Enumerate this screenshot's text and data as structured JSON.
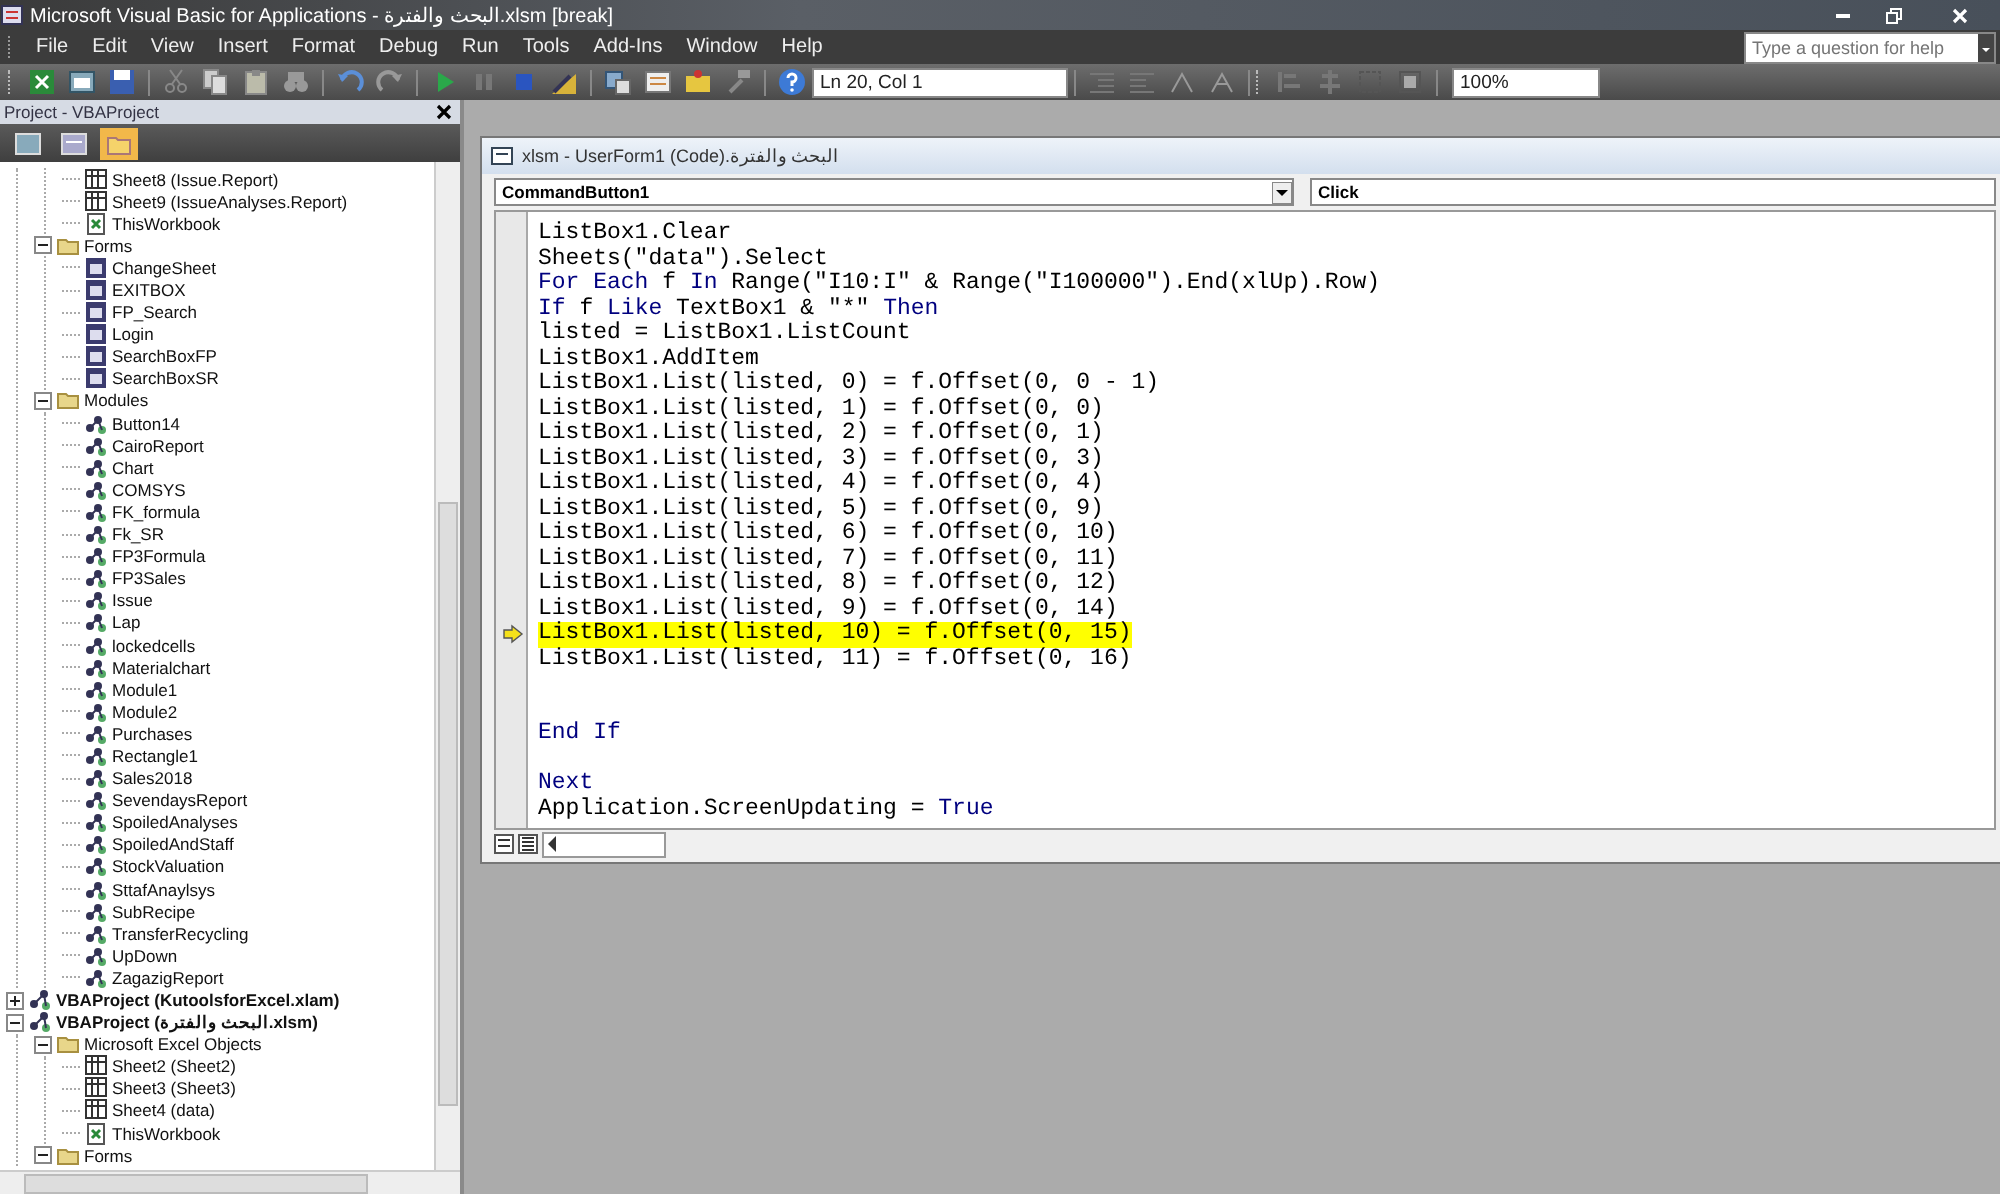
{
  "window": {
    "title": "Microsoft Visual Basic for Applications - البحث والفترة.xlsm [break]"
  },
  "menu": [
    "File",
    "Edit",
    "View",
    "Insert",
    "Format",
    "Debug",
    "Run",
    "Tools",
    "Add-Ins",
    "Window",
    "Help"
  ],
  "help_box": {
    "placeholder": "Type a question for help"
  },
  "toolbar": {
    "position": "Ln 20, Col 1",
    "zoom": "100%"
  },
  "project_pane": {
    "title": "Project - VBAProject",
    "tree": [
      {
        "kind": "offscreen",
        "children": [
          {
            "kind": "offscreen",
            "children": [
              {
                "kind": "sheet",
                "label": "Sheet8 (Issue.Report)"
              },
              {
                "kind": "sheet",
                "label": "Sheet9 (IssueAnalyses.Report)"
              },
              {
                "kind": "workbook",
                "label": "ThisWorkbook"
              }
            ]
          },
          {
            "kind": "folder",
            "label": "Forms",
            "expanded": true,
            "children": [
              {
                "kind": "form",
                "label": "ChangeSheet"
              },
              {
                "kind": "form",
                "label": "EXITBOX"
              },
              {
                "kind": "form",
                "label": "FP_Search"
              },
              {
                "kind": "form",
                "label": "Login"
              },
              {
                "kind": "form",
                "label": "SearchBoxFP"
              },
              {
                "kind": "form",
                "label": "SearchBoxSR"
              }
            ]
          },
          {
            "kind": "folder",
            "label": "Modules",
            "expanded": true,
            "children": [
              {
                "kind": "module",
                "label": "Button14"
              },
              {
                "kind": "module",
                "label": "CairoReport"
              },
              {
                "kind": "module",
                "label": "Chart"
              },
              {
                "kind": "module",
                "label": "COMSYS"
              },
              {
                "kind": "module",
                "label": "FK_formula"
              },
              {
                "kind": "module",
                "label": "Fk_SR"
              },
              {
                "kind": "module",
                "label": "FP3Formula"
              },
              {
                "kind": "module",
                "label": "FP3Sales"
              },
              {
                "kind": "module",
                "label": "Issue"
              },
              {
                "kind": "module",
                "label": "Lap"
              },
              {
                "kind": "module",
                "label": "lockedcells"
              },
              {
                "kind": "module",
                "label": "Materialchart"
              },
              {
                "kind": "module",
                "label": "Module1"
              },
              {
                "kind": "module",
                "label": "Module2"
              },
              {
                "kind": "module",
                "label": "Purchases"
              },
              {
                "kind": "module",
                "label": "Rectangle1"
              },
              {
                "kind": "module",
                "label": "Sales2018"
              },
              {
                "kind": "module",
                "label": "SevendaysReport"
              },
              {
                "kind": "module",
                "label": "SpoiledAnalyses"
              },
              {
                "kind": "module",
                "label": "SpoiledAndStaff"
              },
              {
                "kind": "module",
                "label": "StockValuation"
              },
              {
                "kind": "module",
                "label": "SttafAnaylsys"
              },
              {
                "kind": "module",
                "label": "SubRecipe"
              },
              {
                "kind": "module",
                "label": "TransferRecycling"
              },
              {
                "kind": "module",
                "label": "UpDown"
              },
              {
                "kind": "module",
                "label": "ZagazigReport"
              }
            ]
          }
        ]
      },
      {
        "kind": "project",
        "label": "VBAProject (KutoolsforExcel.xlam)",
        "expanded": false
      },
      {
        "kind": "project",
        "label": "VBAProject (البحث والفترة.xlsm)",
        "expanded": true,
        "children": [
          {
            "kind": "folder",
            "label": "Microsoft Excel Objects",
            "expanded": true,
            "children": [
              {
                "kind": "sheet",
                "label": "Sheet2 (Sheet2)"
              },
              {
                "kind": "sheet",
                "label": "Sheet3 (Sheet3)"
              },
              {
                "kind": "sheet",
                "label": "Sheet4 (data)"
              },
              {
                "kind": "workbook",
                "label": "ThisWorkbook"
              }
            ]
          },
          {
            "kind": "folder",
            "label": "Forms",
            "expanded": true
          }
        ]
      }
    ]
  },
  "code_window": {
    "title": "البحث والفترة.xlsm - UserForm1 (Code)",
    "object": "CommandButton1",
    "procedure": "Click",
    "lines": [
      {
        "kind": "code",
        "current": false,
        "segments": [
          {
            "text": "ListBox1.Clear",
            "keyword": false
          }
        ]
      },
      {
        "kind": "code",
        "current": false,
        "segments": [
          {
            "text": "Sheets(\"data\").Select",
            "keyword": false
          }
        ]
      },
      {
        "kind": "code",
        "current": false,
        "segments": [
          {
            "text": "For Each",
            "keyword": true
          },
          {
            "text": " f ",
            "keyword": false
          },
          {
            "text": "In",
            "keyword": true
          },
          {
            "text": " Range(\"I10:I\" & Range(\"I100000\").End(xlUp).Row)",
            "keyword": false
          }
        ]
      },
      {
        "kind": "code",
        "current": false,
        "segments": [
          {
            "text": "If",
            "keyword": true
          },
          {
            "text": " f ",
            "keyword": false
          },
          {
            "text": "Like",
            "keyword": true
          },
          {
            "text": " TextBox1 & \"*\" ",
            "keyword": false
          },
          {
            "text": "Then",
            "keyword": true
          }
        ]
      },
      {
        "kind": "code",
        "current": false,
        "segments": [
          {
            "text": "listed = ListBox1.ListCount",
            "keyword": false
          }
        ]
      },
      {
        "kind": "code",
        "current": false,
        "segments": [
          {
            "text": "ListBox1.AddItem",
            "keyword": false
          }
        ]
      },
      {
        "kind": "code",
        "current": false,
        "segments": [
          {
            "text": "ListBox1.List(listed, 0) = f.Offset(0, 0 - 1)",
            "keyword": false
          }
        ]
      },
      {
        "kind": "code",
        "current": false,
        "segments": [
          {
            "text": "ListBox1.List(listed, 1) = f.Offset(0, 0)",
            "keyword": false
          }
        ]
      },
      {
        "kind": "code",
        "current": false,
        "segments": [
          {
            "text": "ListBox1.List(listed, 2) = f.Offset(0, 1)",
            "keyword": false
          }
        ]
      },
      {
        "kind": "code",
        "current": false,
        "segments": [
          {
            "text": "ListBox1.List(listed, 3) = f.Offset(0, 3)",
            "keyword": false
          }
        ]
      },
      {
        "kind": "code",
        "current": false,
        "segments": [
          {
            "text": "ListBox1.List(listed, 4) = f.Offset(0, 4)",
            "keyword": false
          }
        ]
      },
      {
        "kind": "code",
        "current": false,
        "segments": [
          {
            "text": "ListBox1.List(listed, 5) = f.Offset(0, 9)",
            "keyword": false
          }
        ]
      },
      {
        "kind": "code",
        "current": false,
        "segments": [
          {
            "text": "ListBox1.List(listed, 6) = f.Offset(0, 10)",
            "keyword": false
          }
        ]
      },
      {
        "kind": "code",
        "current": false,
        "segments": [
          {
            "text": "ListBox1.List(listed, 7) = f.Offset(0, 11)",
            "keyword": false
          }
        ]
      },
      {
        "kind": "code",
        "current": false,
        "segments": [
          {
            "text": "ListBox1.List(listed, 8) = f.Offset(0, 12)",
            "keyword": false
          }
        ]
      },
      {
        "kind": "code",
        "current": false,
        "segments": [
          {
            "text": "ListBox1.List(listed, 9) = f.Offset(0, 14)",
            "keyword": false
          }
        ]
      },
      {
        "kind": "code",
        "current": true,
        "segments": [
          {
            "text": "ListBox1.List(listed, 10) = f.Offset(0, 15)",
            "keyword": false
          }
        ]
      },
      {
        "kind": "code",
        "current": false,
        "segments": [
          {
            "text": "ListBox1.List(listed, 11) = f.Offset(0, 16)",
            "keyword": false
          }
        ]
      },
      {
        "kind": "blank"
      },
      {
        "kind": "blank"
      },
      {
        "kind": "code",
        "current": false,
        "segments": [
          {
            "text": "End If",
            "keyword": true
          }
        ]
      },
      {
        "kind": "blank"
      },
      {
        "kind": "code",
        "current": false,
        "segments": [
          {
            "text": "Next",
            "keyword": true
          }
        ]
      },
      {
        "kind": "code",
        "current": false,
        "segments": [
          {
            "text": "Application.ScreenUpdating = ",
            "keyword": false
          },
          {
            "text": "True",
            "keyword": true
          }
        ]
      }
    ]
  }
}
